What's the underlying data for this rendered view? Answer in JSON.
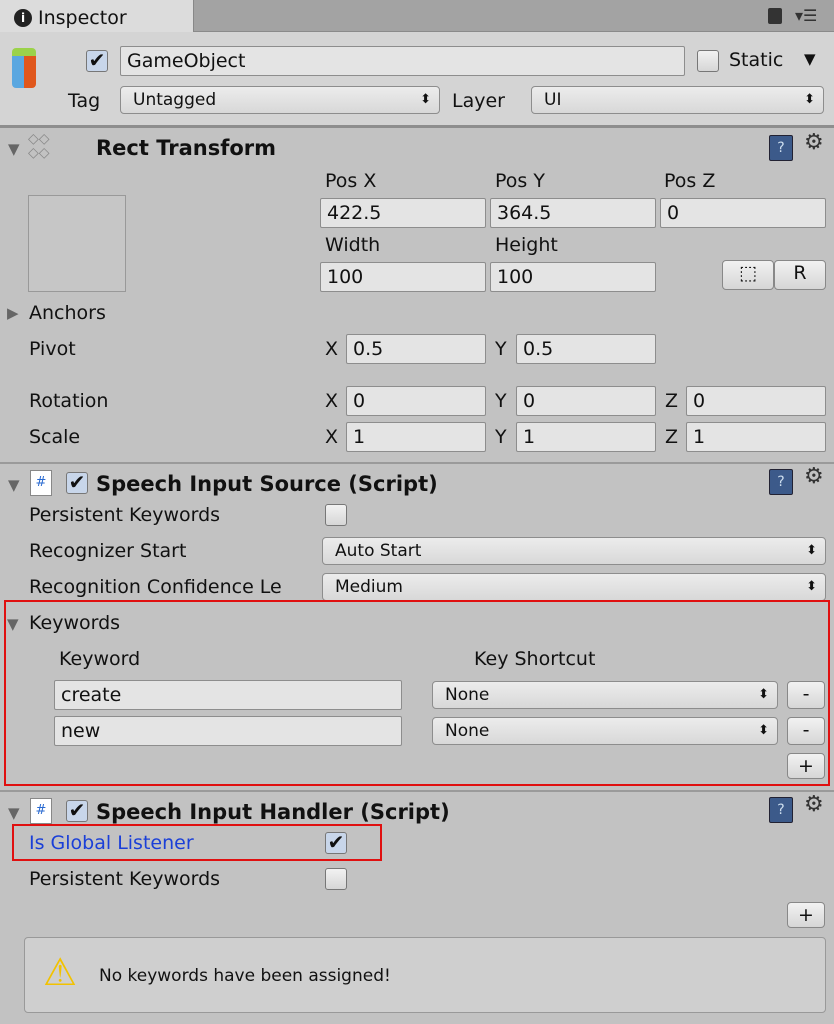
{
  "tab": {
    "title": "Inspector",
    "icon": "info-icon"
  },
  "gameobject": {
    "name": "GameObject",
    "active": true,
    "static_label": "Static",
    "static": false,
    "tag_label": "Tag",
    "tag": "Untagged",
    "layer_label": "Layer",
    "layer": "UI"
  },
  "rect_transform": {
    "title": "Rect Transform",
    "pos_x_label": "Pos X",
    "pos_y_label": "Pos Y",
    "pos_z_label": "Pos Z",
    "pos_x": "422.5",
    "pos_y": "364.5",
    "pos_z": "0",
    "width_label": "Width",
    "height_label": "Height",
    "width": "100",
    "height": "100",
    "r_label": "R",
    "anchors_label": "Anchors",
    "pivot_label": "Pivot",
    "pivot_x": "0.5",
    "pivot_y": "0.5",
    "rotation_label": "Rotation",
    "rot_x": "0",
    "rot_y": "0",
    "rot_z": "0",
    "scale_label": "Scale",
    "scale_x": "1",
    "scale_y": "1",
    "scale_z": "1",
    "x": "X",
    "y": "Y",
    "z": "Z"
  },
  "speech_source": {
    "title": "Speech Input Source (Script)",
    "enabled": true,
    "persistent_label": "Persistent Keywords",
    "persistent": false,
    "recognizer_label": "Recognizer Start",
    "recognizer": "Auto Start",
    "confidence_label": "Recognition Confidence Le",
    "confidence": "Medium",
    "keywords_label": "Keywords",
    "col_keyword": "Keyword",
    "col_shortcut": "Key Shortcut",
    "keywords": [
      {
        "keyword": "create",
        "shortcut": "None"
      },
      {
        "keyword": "new",
        "shortcut": "None"
      }
    ],
    "minus": "-",
    "plus": "+"
  },
  "speech_handler": {
    "title": "Speech Input Handler (Script)",
    "enabled": true,
    "global_label": "Is Global Listener",
    "global": true,
    "persistent_label": "Persistent Keywords",
    "persistent": false,
    "plus": "+",
    "warning": "No keywords have been assigned!"
  },
  "colors": {
    "highlight": "#e01010",
    "link": "#1a3fd8"
  }
}
